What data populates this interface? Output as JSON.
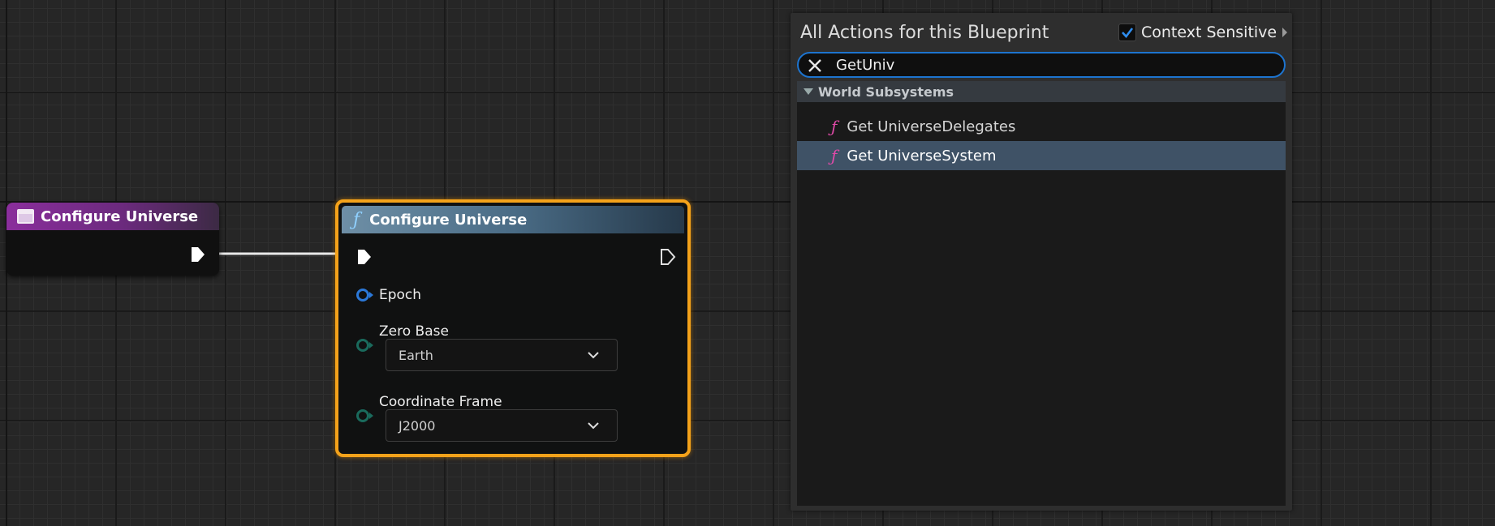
{
  "event_node": {
    "title": "Configure Universe"
  },
  "function_node": {
    "title": "Configure Universe",
    "pins": {
      "epoch": "Epoch",
      "zero_base": {
        "label": "Zero Base",
        "value": "Earth"
      },
      "coordinate_frame": {
        "label": "Coordinate Frame",
        "value": "J2000"
      }
    }
  },
  "action_menu": {
    "title": "All Actions for this Blueprint",
    "context_sensitive": {
      "label": "Context Sensitive",
      "checked": true
    },
    "search": {
      "value": "GetUniv"
    },
    "category": "World Subsystems",
    "items": [
      {
        "label": "Get UniverseDelegates",
        "selected": false
      },
      {
        "label": "Get UniverseSystem",
        "selected": true
      }
    ]
  },
  "colors": {
    "event_header": "#8a2e9c",
    "function_header": "#4a6c86",
    "selected_border": "#f4a21a",
    "search_focus": "#1d74cf",
    "function_icon": "#e04aa8",
    "selection": "#3f5266"
  }
}
